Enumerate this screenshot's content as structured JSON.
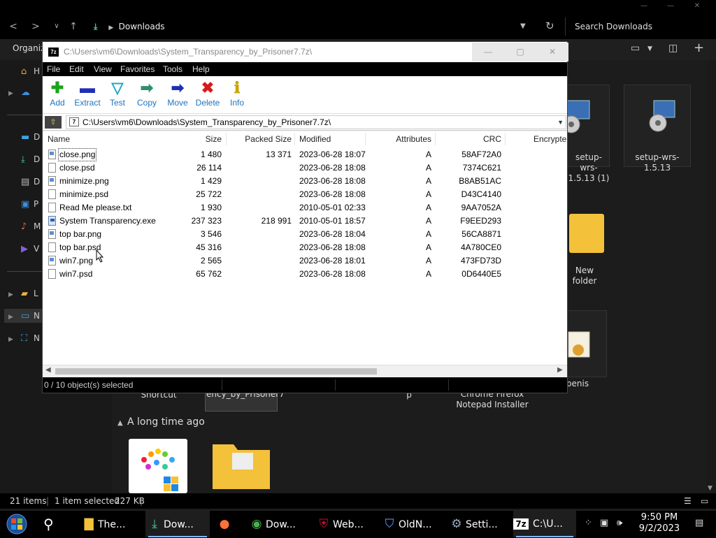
{
  "explorer": {
    "caption_buttons": [
      "—",
      "—",
      "✕"
    ],
    "nav_back": "<",
    "nav_forward": ">",
    "nav_recent": "∨",
    "nav_up": "↑",
    "path": "Downloads",
    "search_placeholder": "Search Downloads",
    "organize_label": "Organize",
    "sidebar_items": [
      "H",
      "",
      "D",
      "D",
      "D",
      "P",
      "M",
      "V",
      "L",
      "N",
      "N"
    ],
    "tiles": [
      {
        "label": "setup-wrs-1.5.13 (1)"
      },
      {
        "label": "setup-wrs-1.5.13"
      },
      {
        "label": "New folder"
      },
      {
        "label": "penis"
      },
      {
        "label": "Shortcut"
      },
      {
        "label": "ency_by_Prisoner7"
      },
      {
        "label": "p"
      },
      {
        "label": "Chrome Firefox Notepad Installer"
      }
    ],
    "group_header": "A long time ago",
    "status": {
      "items": "21 items",
      "selected": "1 item selected",
      "size": "227 KB"
    }
  },
  "sevenzip": {
    "title": "C:\\Users\\vm6\\Downloads\\System_Transparency_by_Prisoner7.7z\\",
    "app_icon": "7z",
    "menu": [
      "File",
      "Edit",
      "View",
      "Favorites",
      "Tools",
      "Help"
    ],
    "toolbar": [
      {
        "label": "Add",
        "icon": "add-icon",
        "color": "#1aa31a",
        "glyph": "✚"
      },
      {
        "label": "Extract",
        "icon": "extract-icon",
        "color": "#1f2fb5",
        "glyph": "▬"
      },
      {
        "label": "Test",
        "icon": "test-icon",
        "color": "#23a7c4",
        "glyph": "▽"
      },
      {
        "label": "Copy",
        "icon": "copy-icon",
        "color": "#2f8f6a",
        "glyph": "➡"
      },
      {
        "label": "Move",
        "icon": "move-icon",
        "color": "#1f2fb5",
        "glyph": "➡"
      },
      {
        "label": "Delete",
        "icon": "delete-icon",
        "color": "#d41c1c",
        "glyph": "✖"
      },
      {
        "label": "Info",
        "icon": "info-icon",
        "color": "#c9a400",
        "glyph": "ℹ"
      }
    ],
    "path": "C:\\Users\\vm6\\Downloads\\System_Transparency_by_Prisoner7.7z\\",
    "columns": [
      "Name",
      "Size",
      "Packed Size",
      "Modified",
      "Attributes",
      "CRC",
      "Encrypte"
    ],
    "files": [
      {
        "name": "close.png",
        "size": "1 480",
        "packed": "13 371",
        "modified": "2023-06-28 18:07",
        "attr": "A",
        "crc": "58AF72A0",
        "type": "img"
      },
      {
        "name": "close.psd",
        "size": "26 114",
        "packed": "",
        "modified": "2023-06-28 18:08",
        "attr": "A",
        "crc": "7374C621",
        "type": "doc"
      },
      {
        "name": "minimize.png",
        "size": "1 429",
        "packed": "",
        "modified": "2023-06-28 18:08",
        "attr": "A",
        "crc": "B8AB51AC",
        "type": "img"
      },
      {
        "name": "minimize.psd",
        "size": "25 722",
        "packed": "",
        "modified": "2023-06-28 18:08",
        "attr": "A",
        "crc": "D43C4140",
        "type": "doc"
      },
      {
        "name": "Read Me please.txt",
        "size": "1 930",
        "packed": "",
        "modified": "2010-05-01 02:33",
        "attr": "A",
        "crc": "9AA7052A",
        "type": "doc"
      },
      {
        "name": "System Transparency.exe",
        "size": "237 323",
        "packed": "218 991",
        "modified": "2010-05-01 18:57",
        "attr": "A",
        "crc": "F9EED293",
        "type": "exe"
      },
      {
        "name": "top bar.png",
        "size": "3 546",
        "packed": "",
        "modified": "2023-06-28 18:04",
        "attr": "A",
        "crc": "56CA8871",
        "type": "img"
      },
      {
        "name": "top bar.psd",
        "size": "45 316",
        "packed": "",
        "modified": "2023-06-28 18:08",
        "attr": "A",
        "crc": "4A780CE0",
        "type": "doc"
      },
      {
        "name": "win7.png",
        "size": "2 565",
        "packed": "",
        "modified": "2023-06-28 18:01",
        "attr": "A",
        "crc": "473FD73D",
        "type": "img"
      },
      {
        "name": "win7.psd",
        "size": "65 762",
        "packed": "",
        "modified": "2023-06-28 18:08",
        "attr": "A",
        "crc": "0D6440E5",
        "type": "doc"
      }
    ],
    "status": "0 / 10 object(s) selected"
  },
  "taskbar": {
    "items": [
      {
        "label": "The...",
        "icon": "folder-icon",
        "color": "#f3c13a",
        "glyph": "▇",
        "active": false
      },
      {
        "label": "Dow...",
        "icon": "download-icon",
        "color": "#4ec9b0",
        "glyph": "⤓",
        "active": true
      },
      {
        "label": "",
        "icon": "firefox-icon",
        "color": "#ff7139",
        "glyph": "●",
        "active": false
      },
      {
        "label": "Dow...",
        "icon": "chrome-icon",
        "color": "#4caf50",
        "glyph": "◉",
        "active": false
      },
      {
        "label": "Web...",
        "icon": "mcafee-icon",
        "color": "#c8102e",
        "glyph": "⛨",
        "active": false
      },
      {
        "label": "OldN...",
        "icon": "shield-icon",
        "color": "#6aa0ff",
        "glyph": "⛉",
        "active": false
      },
      {
        "label": "Setti...",
        "icon": "gear-icon",
        "color": "#9ab",
        "glyph": "⚙",
        "active": false
      },
      {
        "label": "C:\\U...",
        "icon": "sevenzip-icon",
        "color": "#fff",
        "glyph": "7z",
        "active": true
      }
    ],
    "time": "9:50 PM",
    "date": "9/2/2023"
  }
}
